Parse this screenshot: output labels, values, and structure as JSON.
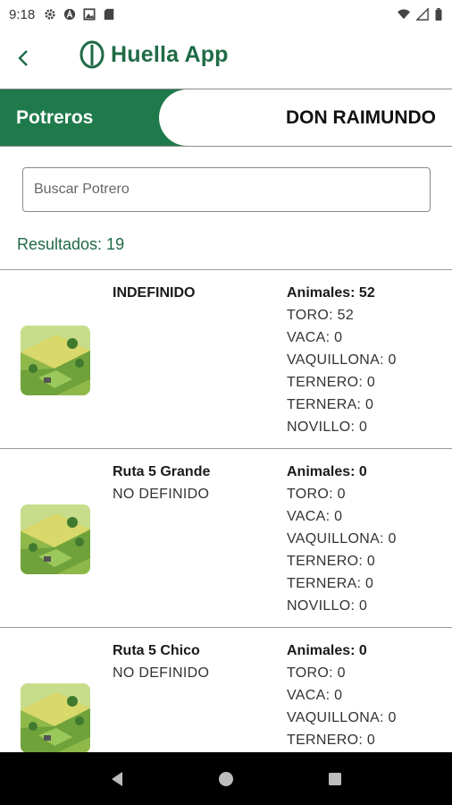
{
  "status_bar": {
    "time": "9:18",
    "left_icons": [
      "gear-icon",
      "a-icon",
      "image-icon",
      "sd-card-icon"
    ],
    "right_icons": [
      "wifi-icon",
      "signal-icon",
      "battery-icon"
    ]
  },
  "app_bar": {
    "title": "Huella App"
  },
  "header": {
    "tab": "Potreros",
    "farm_name": "DON RAIMUNDO",
    "colors": {
      "green": "#1f7a4b"
    }
  },
  "search": {
    "placeholder": "Buscar Potrero",
    "value": ""
  },
  "results": {
    "label": "Resultados: 19"
  },
  "potreros": [
    {
      "name": "INDEFINIDO",
      "subtitle": "",
      "total": "Animales: 52",
      "rows": [
        "TORO: 52",
        "VACA: 0",
        "VAQUILLONA: 0",
        "TERNERO: 0",
        "TERNERA: 0",
        "NOVILLO: 0"
      ]
    },
    {
      "name": "Ruta 5 Grande",
      "subtitle": "NO DEFINIDO",
      "total": "Animales: 0",
      "rows": [
        "TORO: 0",
        "VACA: 0",
        "VAQUILLONA: 0",
        "TERNERO: 0",
        "TERNERA: 0",
        "NOVILLO: 0"
      ]
    },
    {
      "name": "Ruta 5 Chico",
      "subtitle": "NO DEFINIDO",
      "total": "Animales: 0",
      "rows": [
        "TORO: 0",
        "VACA: 0",
        "VAQUILLONA: 0",
        "TERNERO: 0"
      ]
    }
  ],
  "nav": [
    "back-triangle-icon",
    "home-circle-icon",
    "recents-square-icon"
  ]
}
